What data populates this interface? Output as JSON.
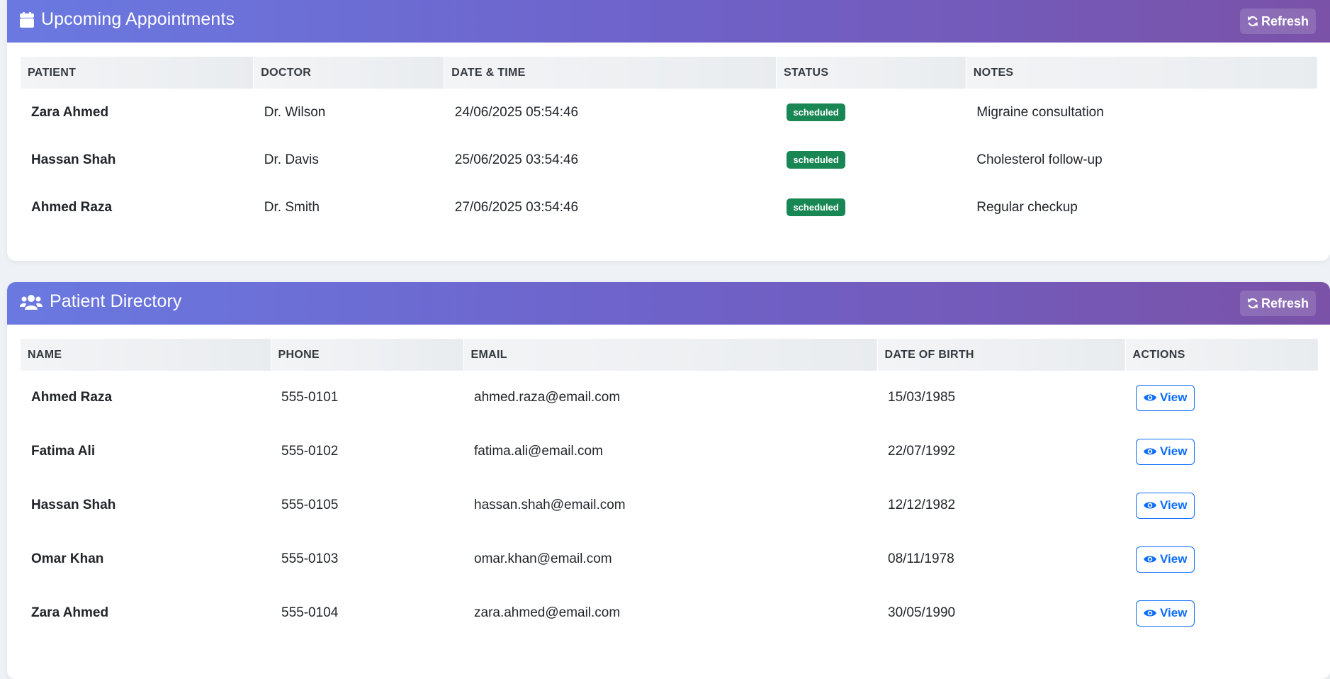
{
  "appointments": {
    "title": "Upcoming Appointments",
    "refresh_label": "Refresh",
    "columns": [
      "PATIENT",
      "DOCTOR",
      "DATE & TIME",
      "STATUS",
      "NOTES"
    ],
    "rows": [
      {
        "patient": "Zara Ahmed",
        "doctor": "Dr. Wilson",
        "datetime": "24/06/2025 05:54:46",
        "status": "scheduled",
        "notes": "Migraine consultation"
      },
      {
        "patient": "Hassan Shah",
        "doctor": "Dr. Davis",
        "datetime": "25/06/2025 03:54:46",
        "status": "scheduled",
        "notes": "Cholesterol follow-up"
      },
      {
        "patient": "Ahmed Raza",
        "doctor": "Dr. Smith",
        "datetime": "27/06/2025 03:54:46",
        "status": "scheduled",
        "notes": "Regular checkup"
      }
    ]
  },
  "patients": {
    "title": "Patient Directory",
    "refresh_label": "Refresh",
    "columns": [
      "NAME",
      "PHONE",
      "EMAIL",
      "DATE OF BIRTH",
      "ACTIONS"
    ],
    "view_label": "View",
    "rows": [
      {
        "name": "Ahmed Raza",
        "phone": "555-0101",
        "email": "ahmed.raza@email.com",
        "dob": "15/03/1985"
      },
      {
        "name": "Fatima Ali",
        "phone": "555-0102",
        "email": "fatima.ali@email.com",
        "dob": "22/07/1992"
      },
      {
        "name": "Hassan Shah",
        "phone": "555-0105",
        "email": "hassan.shah@email.com",
        "dob": "12/12/1982"
      },
      {
        "name": "Omar Khan",
        "phone": "555-0103",
        "email": "omar.khan@email.com",
        "dob": "08/11/1978"
      },
      {
        "name": "Zara Ahmed",
        "phone": "555-0104",
        "email": "zara.ahmed@email.com",
        "dob": "30/05/1990"
      }
    ]
  },
  "icons": {
    "appointments_header": "calendar-icon",
    "patients_header": "users-icon",
    "refresh": "refresh-icon",
    "view": "eye-icon"
  },
  "colors": {
    "header_gradient_start": "#6a79e0",
    "header_gradient_end": "#7a52a8",
    "status_badge": "#198754",
    "view_button": "#0d6efd"
  }
}
